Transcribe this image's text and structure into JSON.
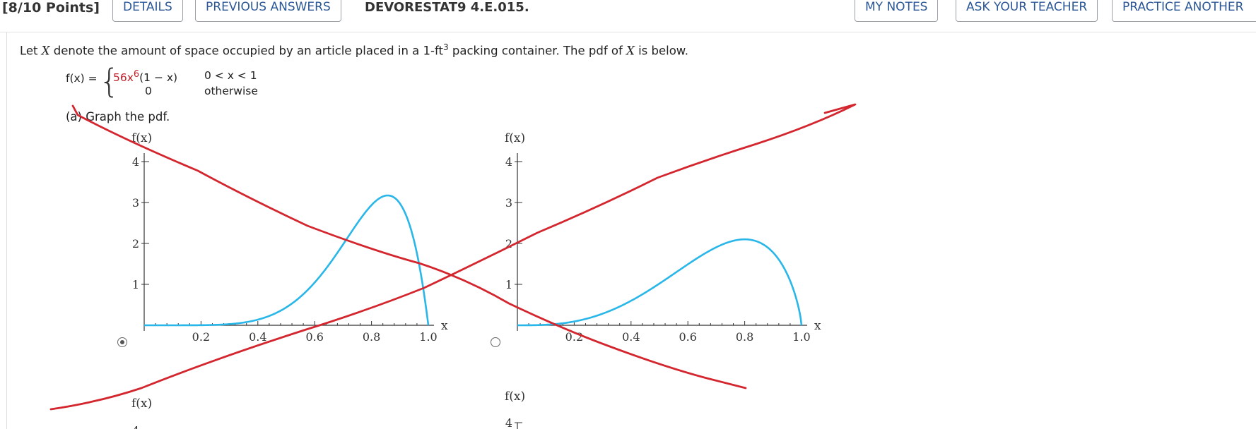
{
  "header": {
    "points": "[8/10 Points]",
    "details_label": "DETAILS",
    "previous_answers_label": "PREVIOUS ANSWERS",
    "question_id": "DEVORESTAT9 4.E.015.",
    "my_notes_label": "MY NOTES",
    "ask_teacher_label": "ASK YOUR TEACHER",
    "practice_another_label": "PRACTICE ANOTHER"
  },
  "question": {
    "text_before": "Let ",
    "var_x": "X",
    "text_mid": " denote the amount of space occupied by an article placed in a 1-ft",
    "superscript": "3",
    "text_after": " packing container. The pdf of ",
    "var_x2": "X",
    "text_end": " is below.",
    "pdf_lhs": "f(x) =",
    "case1_expr_red": "56x",
    "case1_exp": "6",
    "case1_tail": "(1 − x)",
    "case1_cond": "0 < x < 1",
    "case2_expr": "0",
    "case2_cond": "otherwise",
    "part_a": "(a) Graph the pdf."
  },
  "options": [
    {
      "selected": true
    },
    {
      "selected": false
    }
  ],
  "colors": {
    "curve": "#29b6e8",
    "annotation": "#d3262e",
    "link": "#2b5797"
  },
  "chart_data": [
    {
      "type": "line",
      "xlabel": "x",
      "ylabel": "f(x)",
      "xticks": [
        "0.2",
        "0.4",
        "0.6",
        "0.8",
        "1.0"
      ],
      "yticks": [
        "1",
        "2",
        "3",
        "4"
      ],
      "xlim": [
        0,
        1.0
      ],
      "ylim": [
        0,
        4
      ],
      "function": "56*x^6*(1-x)",
      "peak": {
        "x": 0.857,
        "y": 3.15
      }
    },
    {
      "type": "line",
      "xlabel": "x",
      "ylabel": "f(x)",
      "xticks": [
        "0.2",
        "0.4",
        "0.6",
        "0.8",
        "1.0"
      ],
      "yticks": [
        "1",
        "2",
        "3",
        "4"
      ],
      "xlim": [
        0,
        1.0
      ],
      "ylim": [
        0,
        4
      ],
      "function": "x^3*(1-x)^(3/4) scaled",
      "peak": {
        "x": 0.75,
        "y": 2.1
      }
    }
  ],
  "lower_charts": {
    "ylabel": "f(x)",
    "ytick_top": "4"
  }
}
